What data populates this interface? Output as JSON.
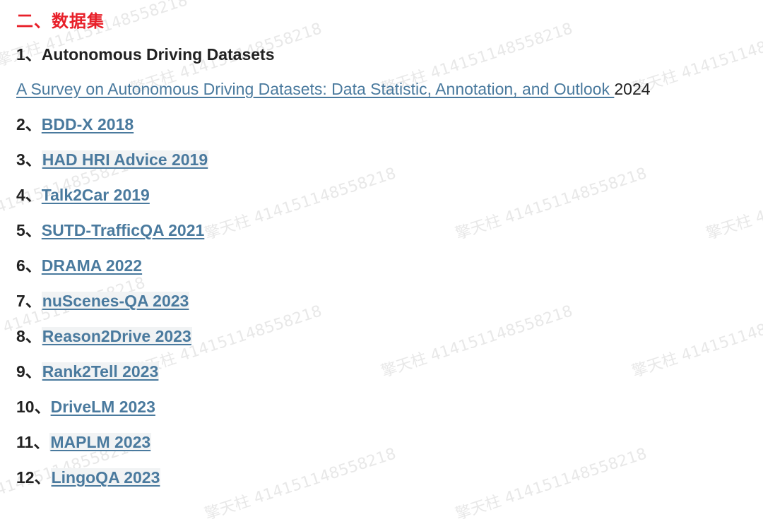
{
  "section_title": "二、数据集",
  "separator": "、",
  "items": [
    {
      "num": "1",
      "text": "Autonomous Driving Datasets"
    },
    {
      "num": "2",
      "link": "BDD-X 2018"
    },
    {
      "num": "3",
      "link": "HAD HRI Advice 2019"
    },
    {
      "num": "4",
      "link": "Talk2Car 2019"
    },
    {
      "num": "5",
      "link": "SUTD-TrafficQA 2021"
    },
    {
      "num": "6",
      "link": "DRAMA 2022"
    },
    {
      "num": "7",
      "link": "nuScenes-QA 2023"
    },
    {
      "num": "8",
      "link": "Reason2Drive 2023"
    },
    {
      "num": "9",
      "link": "Rank2Tell 2023"
    },
    {
      "num": "10",
      "link": "DriveLM 2023"
    },
    {
      "num": "11",
      "link": "MAPLM 2023"
    },
    {
      "num": "12",
      "link": "LingoQA 2023"
    }
  ],
  "survey": {
    "link": "A Survey on Autonomous Driving Datasets: Data Statistic, Annotation, and Outlook ",
    "year": "2024"
  },
  "watermark": "擎天柱 414151148558218"
}
